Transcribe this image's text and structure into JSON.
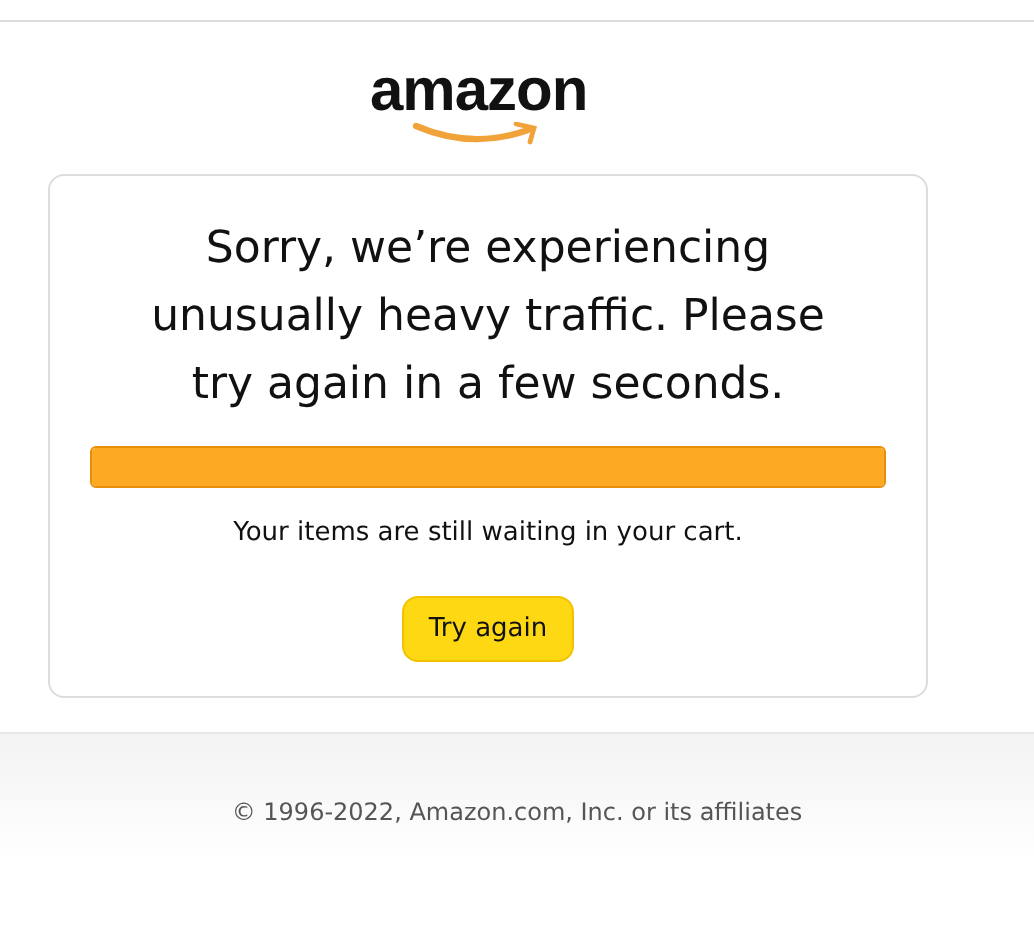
{
  "logo": {
    "text": "amazon"
  },
  "message": {
    "title": "Sorry, we’re experiencing unusually heavy traffic. Please try again in a few seconds.",
    "progress": {
      "level": 1
    },
    "note": "Your items are still waiting in your cart.",
    "button": "Try again"
  },
  "footer": {
    "copyright": "© 1996-2022, Amazon.com, Inc. or its affiliates"
  }
}
